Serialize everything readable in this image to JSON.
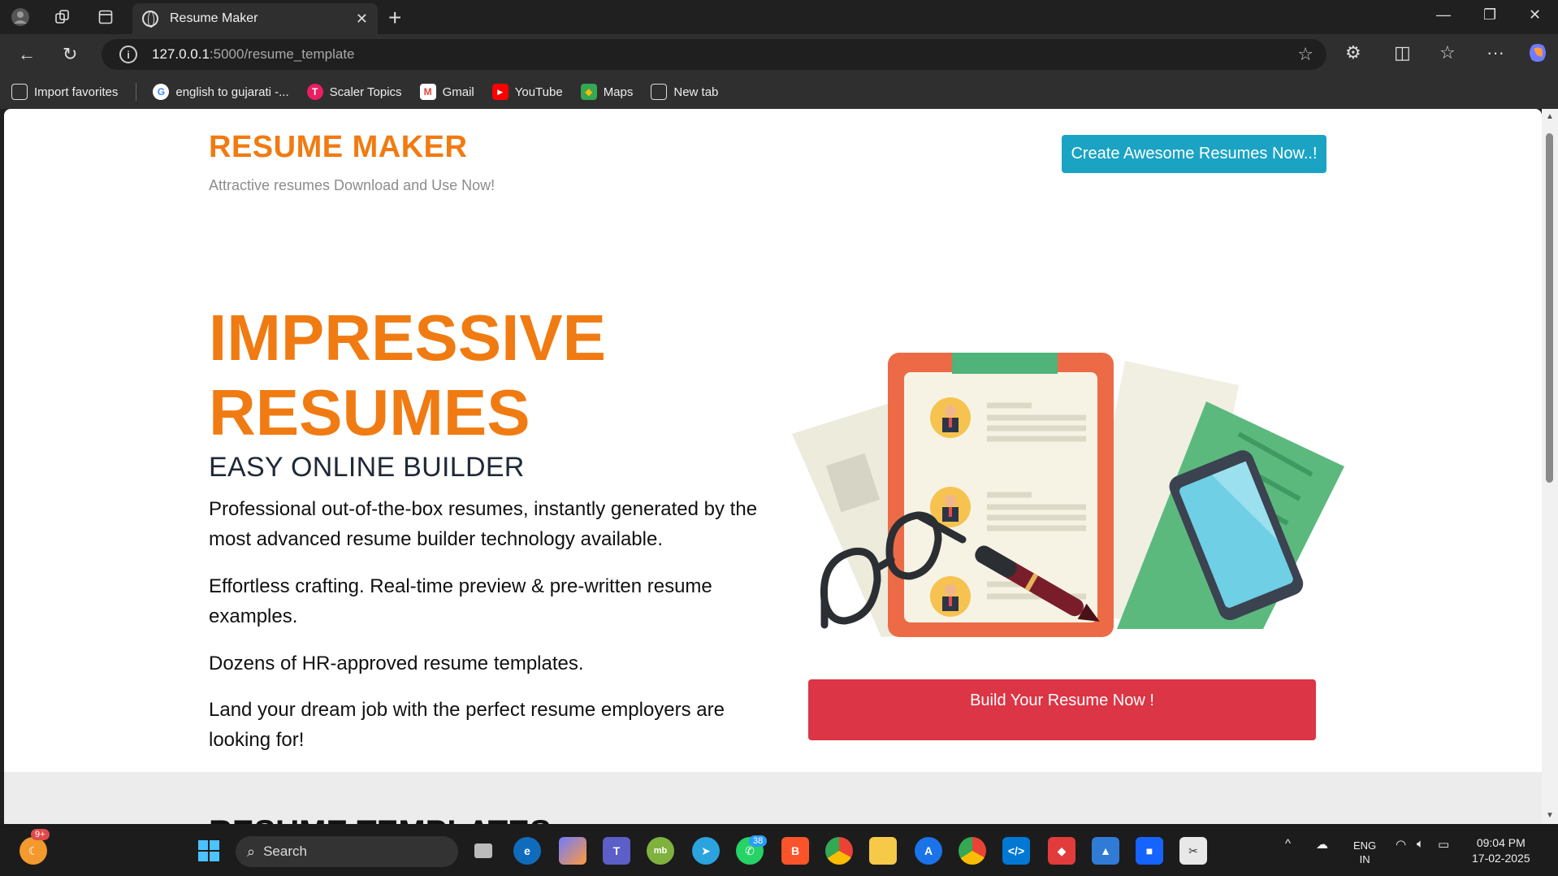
{
  "browser": {
    "tab_title": "Resume Maker",
    "url_host": "127.0.0.1",
    "url_path": ":5000/resume_template",
    "bookmarks": [
      {
        "label": "Import favorites",
        "icon": "import-icon",
        "color": "#dddddd"
      },
      {
        "label": "english to gujarati -...",
        "icon": "google-icon",
        "color": "#4285f4"
      },
      {
        "label": "Scaler Topics",
        "icon": "scaler-icon",
        "color": "#e91e63"
      },
      {
        "label": "Gmail",
        "icon": "gmail-icon",
        "color": "#ea4335"
      },
      {
        "label": "YouTube",
        "icon": "youtube-icon",
        "color": "#ff0000"
      },
      {
        "label": "Maps",
        "icon": "maps-icon",
        "color": "#34a853"
      },
      {
        "label": "New tab",
        "icon": "new-tab-icon",
        "color": "#dddddd"
      }
    ]
  },
  "page": {
    "brand": "RESUME MAKER",
    "tagline": "Attractive resumes Download and Use Now!",
    "cta_top": "Create Awesome Resumes Now..!",
    "hero_title_line1": "IMPRESSIVE",
    "hero_title_line2": "RESUMES",
    "hero_subtitle": "EASY ONLINE BUILDER",
    "paragraphs": [
      "Professional out-of-the-box resumes, instantly generated by the most advanced resume builder technology available.",
      "Effortless crafting. Real-time preview & pre-written resume examples.",
      "Dozens of HR-approved resume templates.",
      "Land your dream job with the perfect resume employers are looking for!"
    ],
    "cta_build": "Build Your Resume Now !",
    "next_section_heading": "RESUME TEMPLATES",
    "colors": {
      "brand": "#f07b12",
      "cta_top": "#1ba3c4",
      "cta_build": "#dc3545"
    }
  },
  "taskbar": {
    "search_label": "Search",
    "notification_badge": "9+",
    "whatsapp_badge": "38",
    "language": "ENG",
    "region": "IN",
    "time": "09:04 PM",
    "date": "17-02-2025"
  }
}
